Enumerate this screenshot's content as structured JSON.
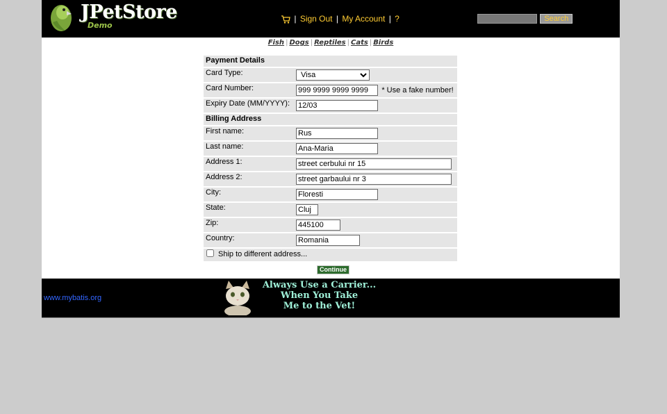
{
  "header": {
    "logo_text": "JPetStore",
    "logo_sub": "Demo",
    "menu": {
      "sign_out": "Sign Out",
      "my_account": "My Account",
      "help": "?"
    },
    "search": {
      "value": "",
      "button_label": "Search"
    }
  },
  "quicklinks": [
    "Fish",
    "Dogs",
    "Reptiles",
    "Cats",
    "Birds"
  ],
  "payment": {
    "section_title": "Payment Details",
    "card_type": {
      "label": "Card Type:",
      "value": "Visa"
    },
    "card_number": {
      "label": "Card Number:",
      "value": "999 9999 9999 9999",
      "hint": "* Use a fake number!"
    },
    "expiry": {
      "label": "Expiry Date (MM/YYYY):",
      "value": "12/03"
    }
  },
  "billing": {
    "section_title": "Billing Address",
    "first_name": {
      "label": "First name:",
      "value": "Rus"
    },
    "last_name": {
      "label": "Last name:",
      "value": "Ana-Maria"
    },
    "address1": {
      "label": "Address 1:",
      "value": "street cerbului nr 15"
    },
    "address2": {
      "label": "Address 2:",
      "value": "street garbaului nr 3"
    },
    "city": {
      "label": "City:",
      "value": "Floresti"
    },
    "state": {
      "label": "State:",
      "value": "Cluj"
    },
    "zip": {
      "label": "Zip:",
      "value": "445100"
    },
    "country": {
      "label": "Country:",
      "value": "Romania"
    }
  },
  "ship_different": {
    "label": "Ship to different address...",
    "checked": false
  },
  "continue_label": "Continue",
  "footer": {
    "link": "www.mybatis.org",
    "banner_text": [
      "Always Use a Carrier...",
      "When You Take",
      "Me to the Vet!"
    ]
  },
  "colors": {
    "header_bg": "#000000",
    "menu_link": "#ffcc33",
    "continue_bg": "#2d6b2d",
    "row_bg": "#e5e5e5",
    "page_bg": "#cccccc"
  }
}
